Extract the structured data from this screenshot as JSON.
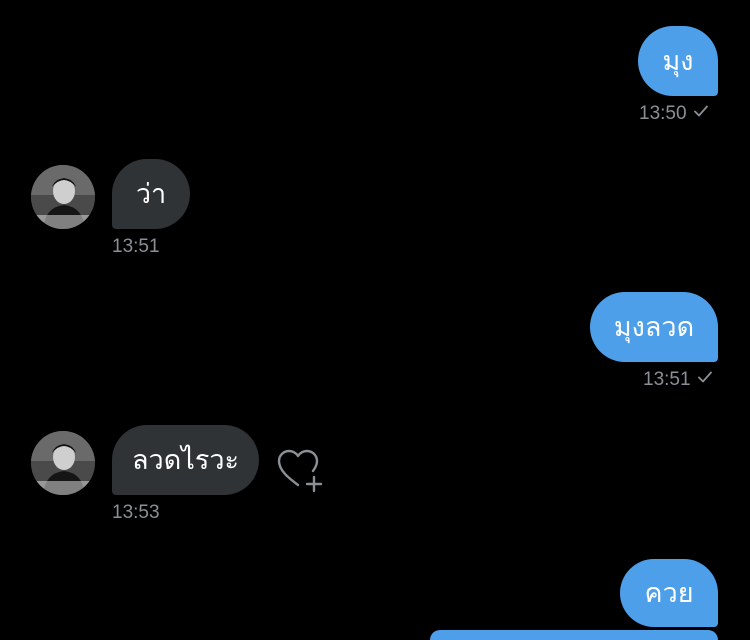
{
  "messages": [
    {
      "direction": "outgoing",
      "text": "มุง",
      "time": "13:50",
      "status_icon": "check-icon"
    },
    {
      "direction": "incoming",
      "text": "ว่า",
      "time": "13:51",
      "avatar": "avatar"
    },
    {
      "direction": "outgoing",
      "text": "มุงลวด",
      "time": "13:51",
      "status_icon": "check-icon"
    },
    {
      "direction": "incoming",
      "text": "ลวดไรวะ",
      "time": "13:53",
      "avatar": "avatar",
      "reaction_button_icon": "heart-plus-icon"
    },
    {
      "direction": "outgoing",
      "text": "ควย"
    }
  ],
  "colors": {
    "background": "#000000",
    "outgoing_bubble": "#4d9fe9",
    "incoming_bubble": "#2f3336",
    "timestamp": "#8b9096",
    "text": "#ffffff"
  }
}
